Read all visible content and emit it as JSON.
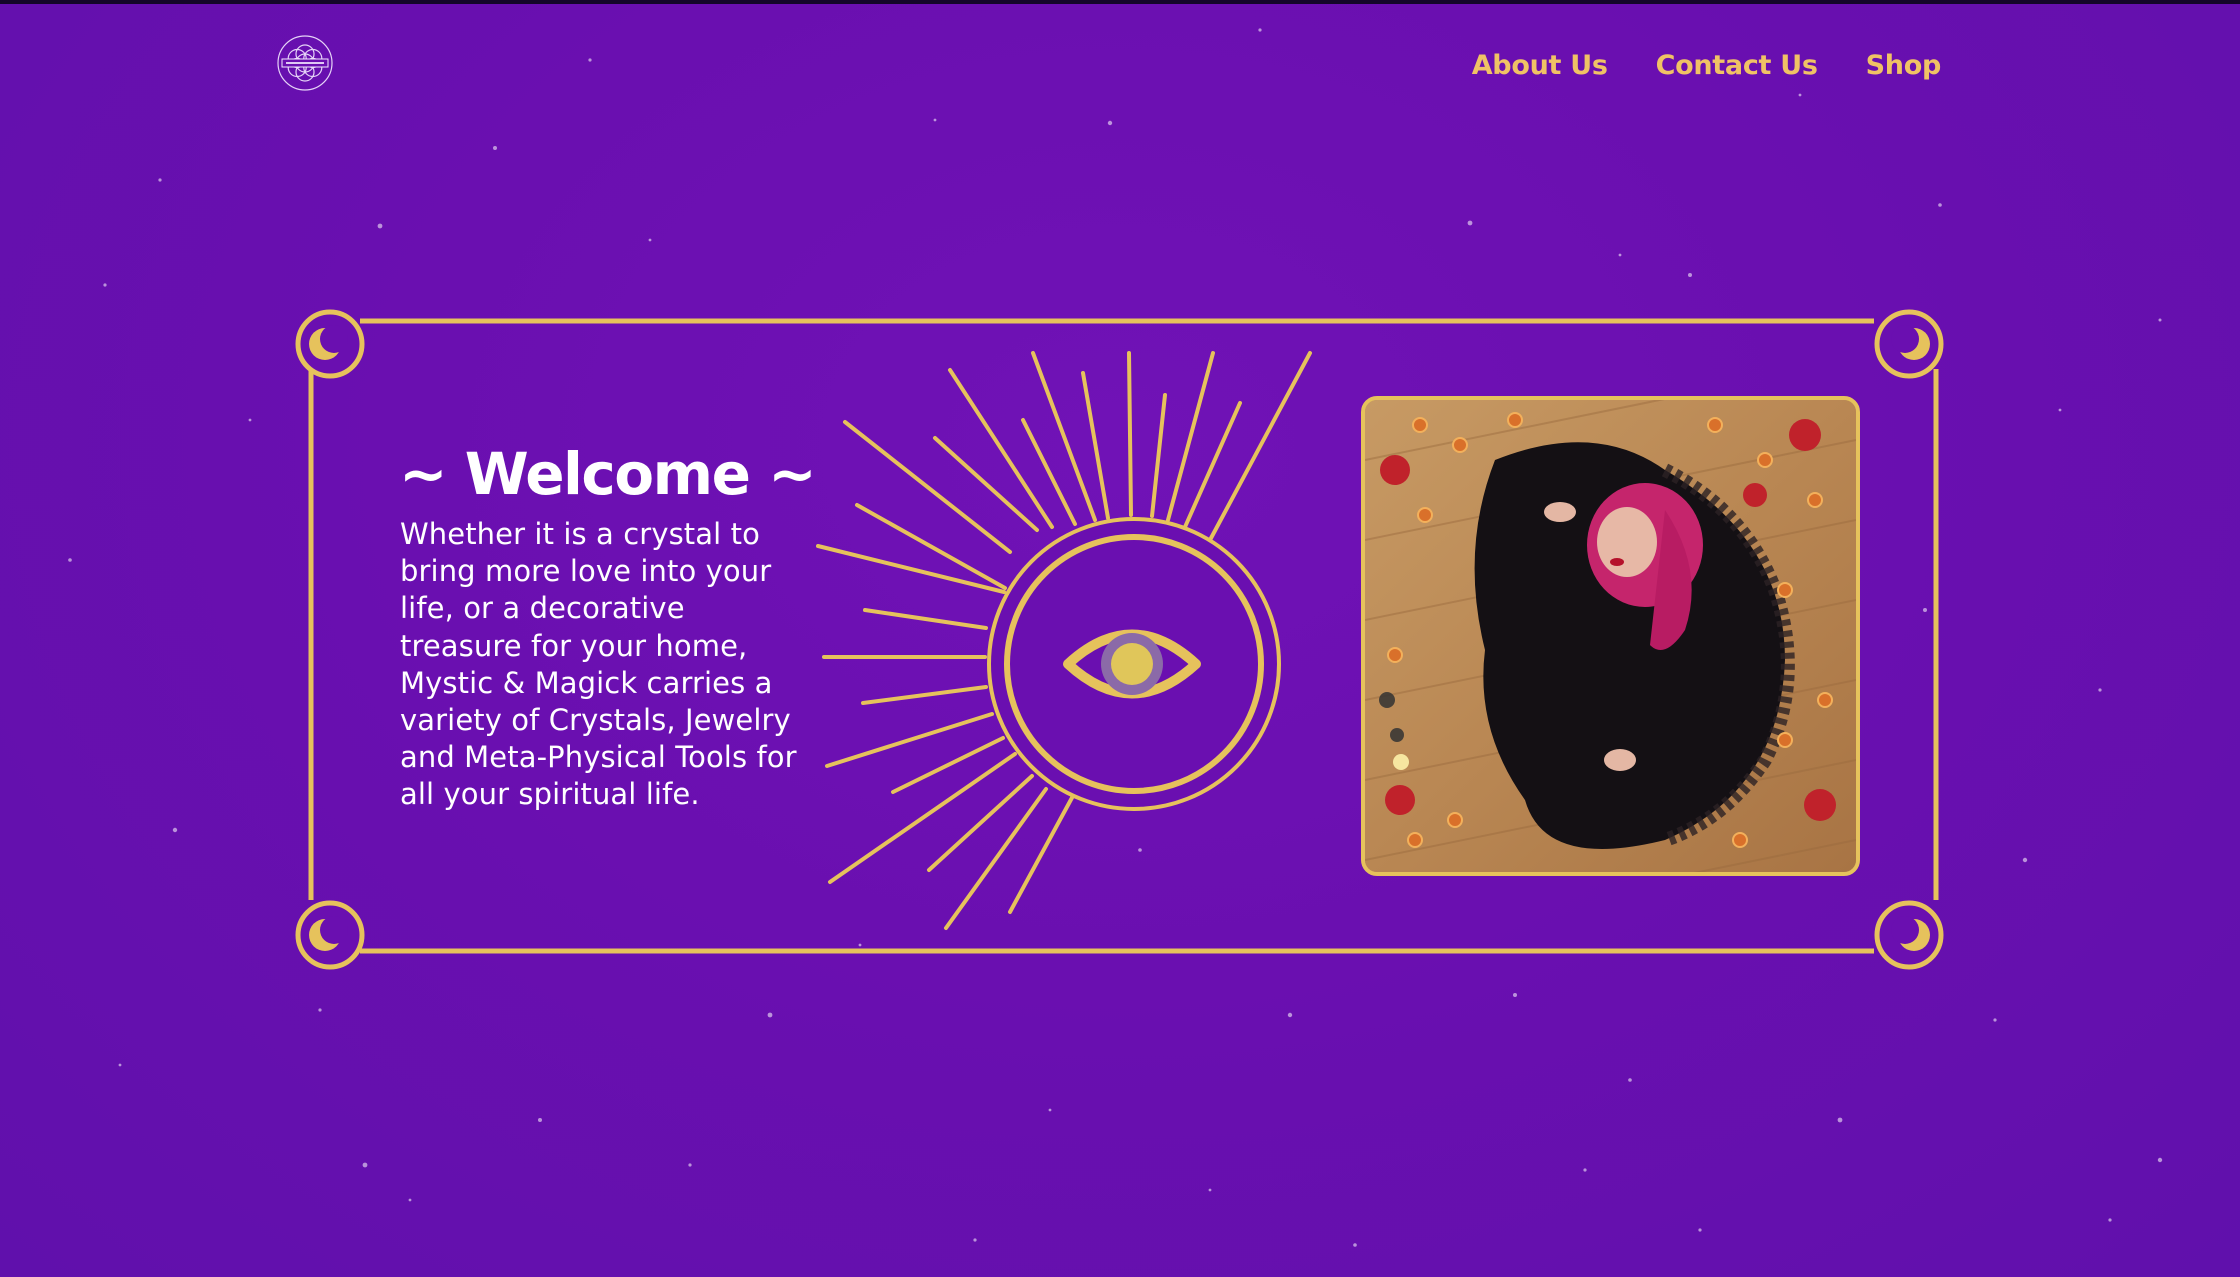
{
  "nav": {
    "logo_alt": "Mystic & Magick",
    "items": [
      {
        "label": "About Us"
      },
      {
        "label": "Contact Us"
      },
      {
        "label": "Shop"
      }
    ]
  },
  "hero": {
    "title": "~ Welcome ~",
    "text": "Whether it is a crystal to bring more love into your life, or a decorative treasure for your home, Mystic & Magick carries a variety of Crystals, Jewelry and Meta-Physical Tools for all your spiritual life."
  },
  "colors": {
    "background": "#6a0fb0",
    "accent_gold": "#e6c25c",
    "nav_text": "#f0c265",
    "body_text": "#ffffff"
  },
  "icons": [
    "flower-of-life-logo-icon",
    "crescent-moon-icon",
    "all-seeing-eye-icon",
    "sun-rays-icon"
  ]
}
